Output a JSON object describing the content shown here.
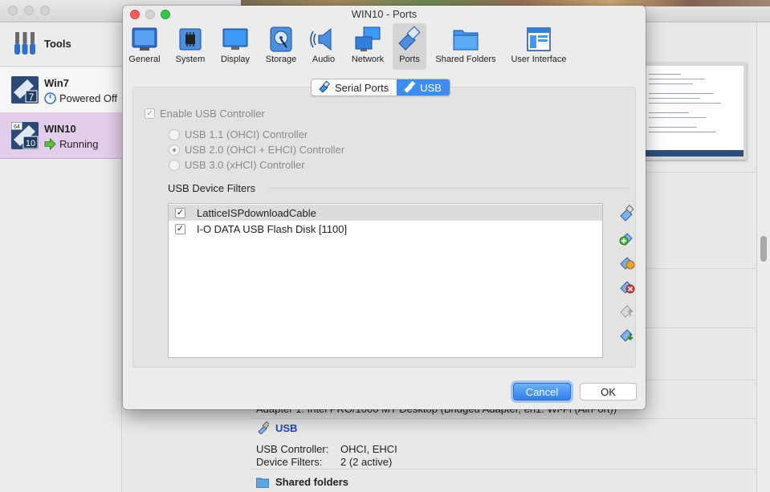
{
  "manager": {
    "tools_label": "Tools",
    "vms": [
      {
        "name": "Win7",
        "state": "Powered Off",
        "os_badge": "7"
      },
      {
        "name": "WIN10",
        "state": "Running",
        "os_badge": "10",
        "arch_badge": "64"
      }
    ],
    "details": {
      "network_line": "Adapter 1:   Intel PRO/1000 MT Desktop (Bridged Adapter, en1: Wi-Fi (AirPort))",
      "usb_heading": "USB",
      "usb_controller_key": "USB Controller:",
      "usb_controller_val": "OHCI, EHCI",
      "device_filters_key": "Device Filters:",
      "device_filters_val": "2 (2 active)",
      "shared_folders_heading": "Shared folders"
    }
  },
  "dialog": {
    "title": "WIN10 - Ports",
    "toolbar": [
      {
        "label": "General",
        "icon": "general-icon"
      },
      {
        "label": "System",
        "icon": "system-chip-icon"
      },
      {
        "label": "Display",
        "icon": "display-monitor-icon"
      },
      {
        "label": "Storage",
        "icon": "storage-disk-icon"
      },
      {
        "label": "Audio",
        "icon": "audio-speaker-icon"
      },
      {
        "label": "Network",
        "icon": "network-icon"
      },
      {
        "label": "Ports",
        "icon": "ports-plug-icon",
        "selected": true
      },
      {
        "label": "Shared Folders",
        "icon": "shared-folder-icon"
      },
      {
        "label": "User Interface",
        "icon": "user-interface-icon"
      }
    ],
    "segments": {
      "serial": "Serial Ports",
      "usb": "USB",
      "active": "usb"
    },
    "enable_usb_label": "Enable USB Controller",
    "controllers": [
      {
        "label": "USB 1.1 (OHCI) Controller",
        "selected": false
      },
      {
        "label": "USB 2.0 (OHCI + EHCI) Controller",
        "selected": true
      },
      {
        "label": "USB 3.0 (xHCI) Controller",
        "selected": false
      }
    ],
    "filters_title": "USB Device Filters",
    "filters": [
      {
        "name": "LatticeISPdownloadCable",
        "checked": true
      },
      {
        "name": "I-O DATA USB Flash Disk [1100]",
        "checked": true
      }
    ],
    "side_buttons": [
      "add-filter-icon",
      "add-from-device-icon",
      "edit-filter-icon",
      "remove-filter-icon",
      "move-up-icon",
      "move-down-icon"
    ],
    "cancel_label": "Cancel",
    "ok_label": "OK"
  }
}
